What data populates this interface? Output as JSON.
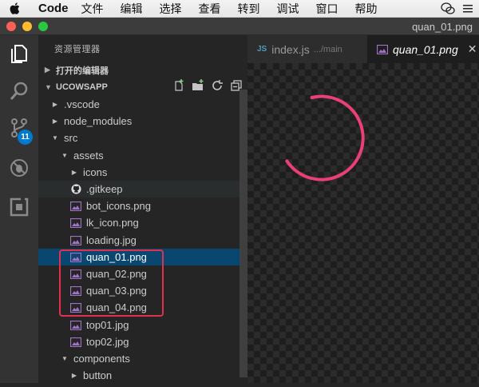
{
  "menubar": {
    "app_name": "Code",
    "items": [
      "文件",
      "编辑",
      "选择",
      "查看",
      "转到",
      "调试",
      "窗口",
      "帮助"
    ]
  },
  "window": {
    "title": "quan_01.png"
  },
  "activity": {
    "scm_badge": "11"
  },
  "sidebar": {
    "title": "资源管理器",
    "open_editors": "打开的编辑器",
    "project": "UCOWSAPP",
    "tree": [
      {
        "label": ".vscode",
        "type": "folder",
        "expanded": false
      },
      {
        "label": "node_modules",
        "type": "folder",
        "expanded": false
      },
      {
        "label": "src",
        "type": "folder",
        "expanded": true
      },
      {
        "label": "assets",
        "type": "folder",
        "expanded": true
      },
      {
        "label": "icons",
        "type": "folder",
        "expanded": false
      },
      {
        "label": ".gitkeep",
        "type": "github"
      },
      {
        "label": "bot_icons.png",
        "type": "image"
      },
      {
        "label": "lk_icon.png",
        "type": "image"
      },
      {
        "label": "loading.jpg",
        "type": "image"
      },
      {
        "label": "quan_01.png",
        "type": "image",
        "selected": true
      },
      {
        "label": "quan_02.png",
        "type": "image"
      },
      {
        "label": "quan_03.png",
        "type": "image"
      },
      {
        "label": "quan_04.png",
        "type": "image"
      },
      {
        "label": "top01.jpg",
        "type": "image"
      },
      {
        "label": "top02.jpg",
        "type": "image"
      },
      {
        "label": "components",
        "type": "folder",
        "expanded": true
      },
      {
        "label": "button",
        "type": "folder",
        "expanded": false
      }
    ]
  },
  "tabs": [
    {
      "icon_text": "JS",
      "label": "index.js",
      "path": ".../main"
    },
    {
      "label": "quan_01.png",
      "active": true
    }
  ],
  "colors": {
    "selection": "#094771",
    "badge": "#007acc",
    "highlight_box": "#e0304e",
    "spinner": "#ec3f76",
    "js_icon": "#519aba"
  }
}
